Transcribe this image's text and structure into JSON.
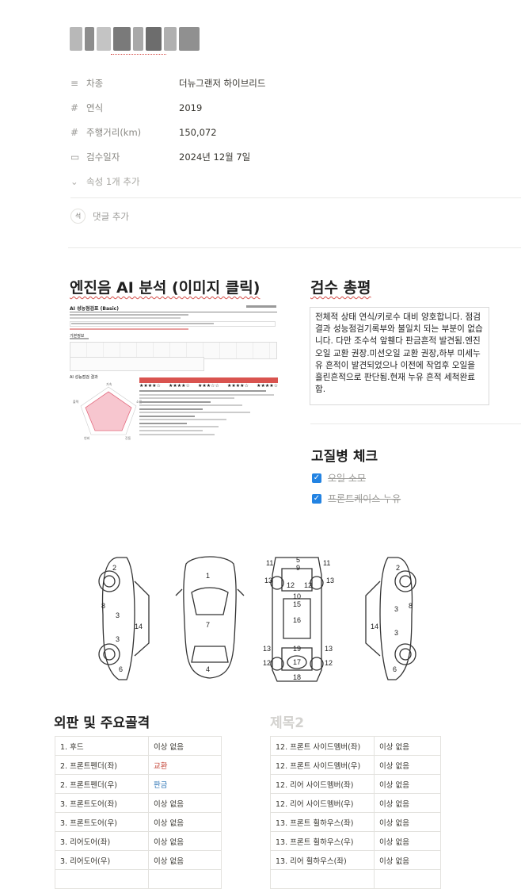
{
  "properties": [
    {
      "icon": "≡",
      "label": "차종",
      "value": "더뉴그랜저 하이브리드"
    },
    {
      "icon": "#",
      "label": "연식",
      "value": "2019"
    },
    {
      "icon": "#",
      "label": "주행거리(km)",
      "value": "150,072"
    },
    {
      "icon": "▭",
      "label": "검수일자",
      "value": "2024년 12월 7일"
    }
  ],
  "add_property_label": "속성 1개 추가",
  "comment": {
    "avatar": "석",
    "label": "댓글 추가"
  },
  "engine_section": {
    "title": "엔진음 AI 분석 (이미지 클릭)",
    "report": {
      "heading": "AI 성능점검표 (Basic)",
      "info_label": "기본정보",
      "ai_label": "AI 성능점검 결과",
      "score_headers": [
        "항목1",
        "항목2",
        "항목3",
        "항목4",
        "항목5"
      ],
      "stars": [
        "★★★★☆",
        "★★★★☆",
        "★★★☆☆",
        "★★★★☆",
        "★★★★☆"
      ]
    }
  },
  "review_section": {
    "title": "검수 총평",
    "text": "전체적 상태 연식/키로수 대비 양호합니다. 점검결과 성능점검기록부와 불일치 되는 부분이 없습니다. 다만 조수석 앞휀다 판금흔적 발견됨.엔진 오일 교환 권장.미션오일 교환 권장,하부 미세누유 흔적이 발견되었으나 이전에 작업후 오일을 흘린흔적으로 판단됨.현재 누유 흔적 세척완료함."
  },
  "chronic_section": {
    "title": "고질병 체크",
    "items": [
      {
        "label": "오일 소모",
        "checked": true
      },
      {
        "label": "프론트케이스 누유",
        "checked": true
      }
    ]
  },
  "diagram_labels": {
    "left_side": [
      "2",
      "8",
      "3",
      "14",
      "3",
      "6"
    ],
    "top": [
      "1",
      "7",
      "4"
    ],
    "under": [
      "5",
      "11",
      "9",
      "11",
      "13",
      "12",
      "12",
      "13",
      "10",
      "15",
      "16",
      "13",
      "19",
      "13",
      "12",
      "17",
      "12",
      "18"
    ],
    "right_side": [
      "2",
      "3",
      "8",
      "14",
      "3",
      "6"
    ]
  },
  "table1": {
    "title": "외판 및 주요골격",
    "rows": [
      {
        "part": "1. 후드",
        "status": "이상 없음",
        "tone": "normal"
      },
      {
        "part": "2. 프론트펜더(좌)",
        "status": "교환",
        "tone": "red"
      },
      {
        "part": "2. 프론트펜더(우)",
        "status": "판금",
        "tone": "blue"
      },
      {
        "part": "3. 프론트도어(좌)",
        "status": "이상 없음",
        "tone": "normal"
      },
      {
        "part": "3. 프론트도어(우)",
        "status": "이상 없음",
        "tone": "normal"
      },
      {
        "part": "3. 리어도어(좌)",
        "status": "이상 없음",
        "tone": "normal"
      },
      {
        "part": "3. 리어도어(우)",
        "status": "이상 없음",
        "tone": "normal"
      }
    ]
  },
  "table2": {
    "title": "제목2",
    "rows": [
      {
        "part": "12. 프론트 사이드멤버(좌)",
        "status": "이상 없음"
      },
      {
        "part": "12. 프론트 사이드멤버(우)",
        "status": "이상 없음"
      },
      {
        "part": "12. 리어 사이드멤버(좌)",
        "status": "이상 없음"
      },
      {
        "part": "12. 리어 사이드멤버(우)",
        "status": "이상 없음"
      },
      {
        "part": "13. 프론트 휠하우스(좌)",
        "status": "이상 없음"
      },
      {
        "part": "13. 프론트 휠하우스(우)",
        "status": "이상 없음"
      },
      {
        "part": "13. 리어 휠하우스(좌)",
        "status": "이상 없음"
      }
    ]
  },
  "colors": {
    "accent": "#2383e2",
    "red": "#c0392b",
    "blue": "#2e75b6"
  }
}
